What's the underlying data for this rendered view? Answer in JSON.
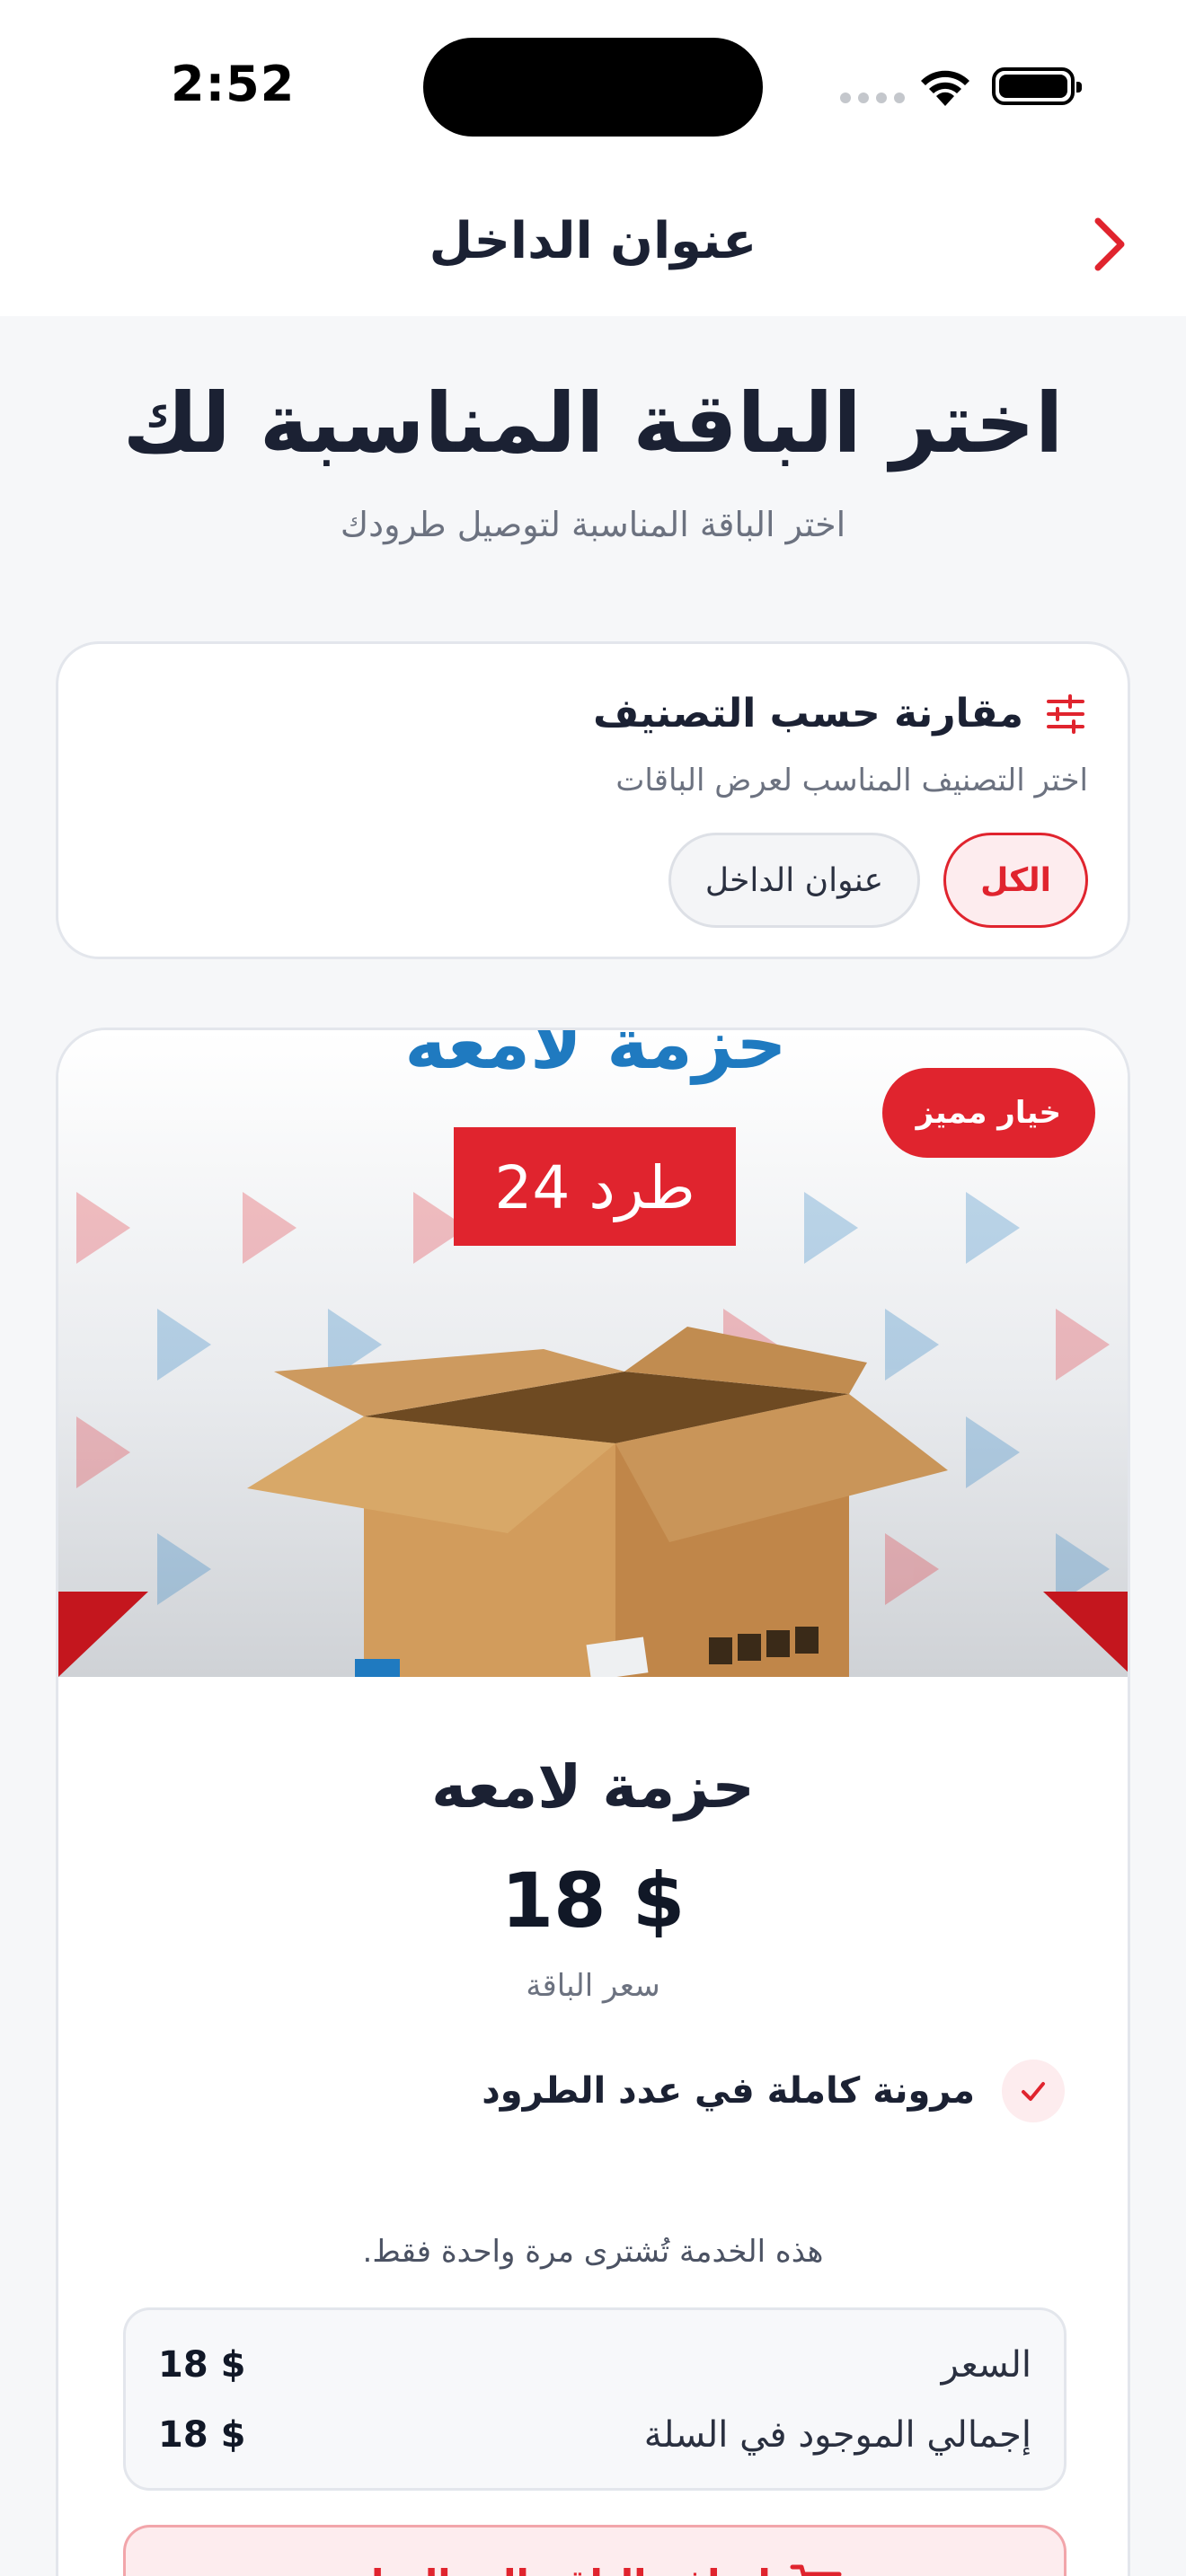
{
  "status_bar": {
    "time": "2:52"
  },
  "nav": {
    "title": "عنوان الداخل"
  },
  "header": {
    "title": "اختر الباقة المناسبة لك",
    "subtitle": "اختر الباقة المناسبة لتوصيل طرودك"
  },
  "filter": {
    "title": "مقارنة حسب التصنيف",
    "subtitle": "اختر التصنيف المناسب لعرض الباقات",
    "chips": [
      {
        "label": "الكل",
        "selected": true
      },
      {
        "label": "عنوان الداخل",
        "selected": false
      }
    ]
  },
  "product": {
    "image_title": "حزمة لامعه",
    "image_count_label": "24 طرد",
    "badge": "خيار مميز",
    "name": "حزمة لامعه",
    "price": "18 $",
    "price_label": "سعر الباقة",
    "features": [
      "مرونة كاملة في عدد الطرود"
    ],
    "purchase_note": "هذه الخدمة تُشترى مرة واحدة فقط.",
    "summary": [
      {
        "label": "السعر",
        "value": "18 $"
      },
      {
        "label": "إجمالي الموجود في السلة",
        "value": "18 $"
      }
    ],
    "cart_button": "إضافة الباقة إلى السلة"
  },
  "colors": {
    "accent": "#e0242e",
    "accent_soft": "#fdecee",
    "text": "#1b2133",
    "muted": "#6c7280",
    "image_blue": "#1f7ac0"
  }
}
